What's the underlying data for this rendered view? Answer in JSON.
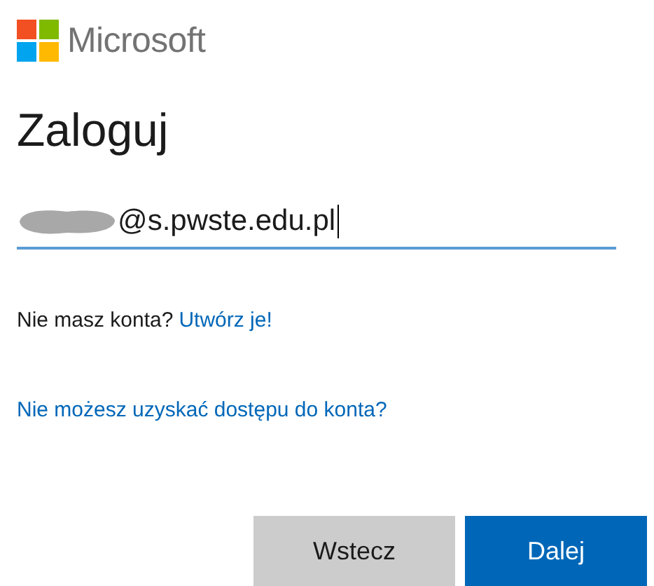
{
  "brand": {
    "name": "Microsoft"
  },
  "title": "Zaloguj",
  "email": {
    "value": "@s.pwste.edu.pl",
    "redacted": true
  },
  "no_account": {
    "text": "Nie masz konta?",
    "link": "Utwórz je!"
  },
  "access_link": "Nie możesz uzyskać dostępu do konta?",
  "buttons": [
    {
      "label": "Wstecz",
      "kind": "secondary"
    },
    {
      "label": "Dalej",
      "kind": "primary"
    }
  ]
}
